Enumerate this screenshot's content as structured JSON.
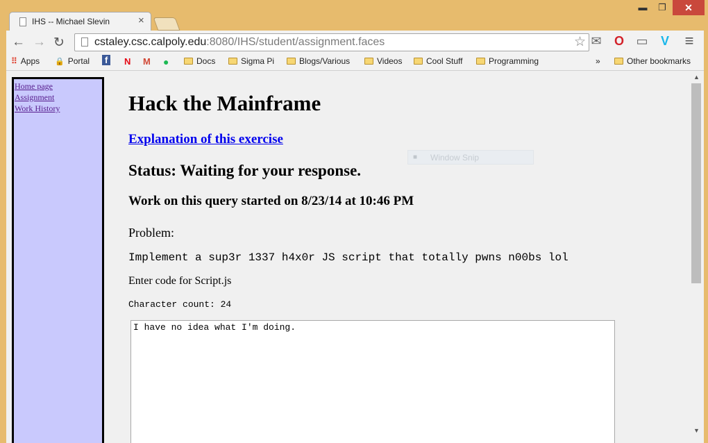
{
  "browser": {
    "tab_title": "IHS -- Michael Slevin",
    "tab_close": "×",
    "url_host": "cstaley.csc.calpoly.edu",
    "url_rest": ":8080/IHS/student/assignment.faces",
    "controls": {
      "minimize": "▬",
      "maximize": "❐",
      "close": "✕"
    },
    "nav": {
      "back": "←",
      "forward": "→",
      "reload": "↻",
      "star": "☆",
      "menu": "≡"
    },
    "extensions": {
      "mail": "✉",
      "opera": "O",
      "cast": "▭",
      "vimeo": "V"
    }
  },
  "bookmarks": {
    "items": [
      {
        "icon": "⠿",
        "label": "Apps"
      },
      {
        "icon": "🔒",
        "label": "Portal"
      },
      {
        "icon": "f",
        "label": ""
      },
      {
        "icon": "N",
        "label": ""
      },
      {
        "icon": "M",
        "label": ""
      },
      {
        "icon": "●",
        "label": ""
      },
      {
        "folder": true,
        "label": "Docs"
      },
      {
        "folder": true,
        "label": "Sigma Pi"
      },
      {
        "folder": true,
        "label": "Blogs/Various"
      },
      {
        "folder": true,
        "label": "Videos"
      },
      {
        "folder": true,
        "label": "Cool Stuff"
      },
      {
        "folder": true,
        "label": "Programming"
      }
    ],
    "overflow": "»",
    "other": "Other bookmarks",
    "colors": {
      "facebook": "#3b5998",
      "netflix": "#e50914",
      "gmail": "#d14836",
      "spotify": "#1db954"
    }
  },
  "sidebar": {
    "links": [
      "Home page",
      "Assignment",
      "Work History"
    ]
  },
  "page": {
    "title": "Hack the Mainframe",
    "explanation_link": "Explanation of this exercise",
    "status": "Status: Waiting for your response.",
    "started": "Work on this query started on 8/23/14 at 10:46 PM",
    "problem_label": "Problem:",
    "problem_text": "Implement a sup3r 1337 h4x0r JS script that totally pwns n00bs lol",
    "enter_code": "Enter code for Script.js",
    "char_count": "Character count: 24",
    "code_value": "I have no idea what I'm doing."
  },
  "overlay": {
    "snip_label": "Window Snip"
  },
  "scroll": {
    "up": "▲",
    "down": "▼"
  }
}
